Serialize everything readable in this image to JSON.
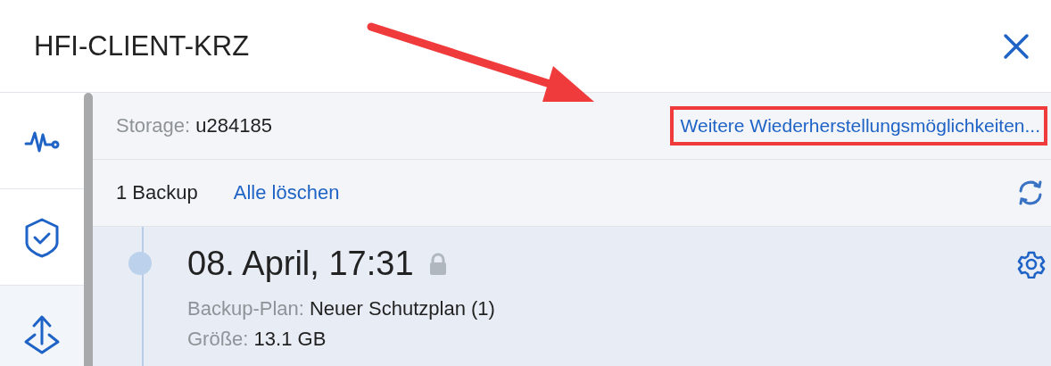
{
  "window": {
    "title": "HFI-CLIENT-KRZ"
  },
  "sidebar": {
    "items": [
      {
        "kind": "activity",
        "selected": false
      },
      {
        "kind": "protection",
        "selected": false
      },
      {
        "kind": "recovery",
        "selected": true
      }
    ]
  },
  "storage": {
    "label": "Storage:",
    "value": "u284185",
    "link": "Weitere Wiederherstellungsmöglichkeiten..."
  },
  "backups": {
    "count": "1 Backup",
    "delete_all": "Alle löschen"
  },
  "backup_items": [
    {
      "date": "08. April, 17:31",
      "locked": true,
      "plan_label": "Backup-Plan:",
      "plan": "Neuer Schutzplan (1)",
      "size_label": "Größe:",
      "size": "13.1 GB"
    }
  ],
  "annotation": {
    "highlight": true
  }
}
